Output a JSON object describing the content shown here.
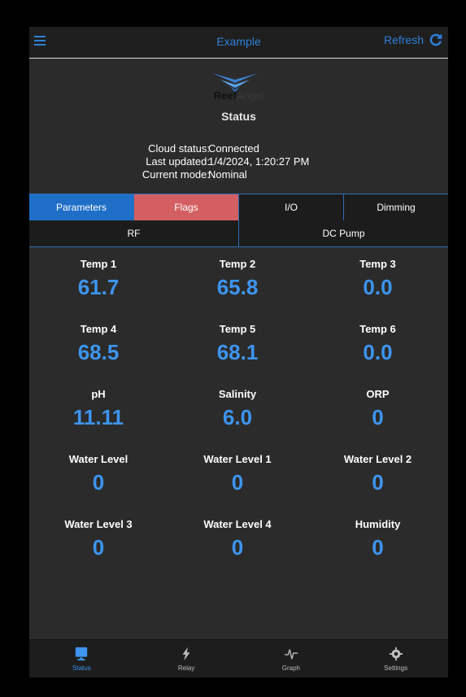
{
  "header": {
    "title": "Example",
    "refresh_label": "Refresh"
  },
  "logo": {
    "reef": "Reef",
    "angel": "Angel"
  },
  "status_heading": "Status",
  "info": [
    {
      "label": "Cloud status:",
      "value": "Connected"
    },
    {
      "label": "Last updated:",
      "value": "1/4/2024, 1:20:27 PM"
    },
    {
      "label": "Current mode:",
      "value": "Nominal"
    }
  ],
  "tabs_row1": [
    "Parameters",
    "Flags",
    "I/O",
    "Dimming"
  ],
  "tabs_row2": [
    "RF",
    "DC Pump"
  ],
  "params": [
    {
      "label": "Temp 1",
      "value": "61.7"
    },
    {
      "label": "Temp 2",
      "value": "65.8"
    },
    {
      "label": "Temp 3",
      "value": "0.0"
    },
    {
      "label": "Temp 4",
      "value": "68.5"
    },
    {
      "label": "Temp 5",
      "value": "68.1"
    },
    {
      "label": "Temp 6",
      "value": "0.0"
    },
    {
      "label": "pH",
      "value": "11.11"
    },
    {
      "label": "Salinity",
      "value": "6.0"
    },
    {
      "label": "ORP",
      "value": "0"
    },
    {
      "label": "Water Level",
      "value": "0"
    },
    {
      "label": "Water Level 1",
      "value": "0"
    },
    {
      "label": "Water Level 2",
      "value": "0"
    },
    {
      "label": "Water Level 3",
      "value": "0"
    },
    {
      "label": "Water Level 4",
      "value": "0"
    },
    {
      "label": "Humidity",
      "value": "0"
    }
  ],
  "bottom_nav": [
    {
      "label": "Status",
      "icon": "monitor-icon"
    },
    {
      "label": "Relay",
      "icon": "lightning-icon"
    },
    {
      "label": "Graph",
      "icon": "pulse-icon"
    },
    {
      "label": "Settings",
      "icon": "gear-icon"
    }
  ],
  "colors": {
    "accent": "#2f7fd8",
    "value": "#3d95ef",
    "flags": "#d35f62",
    "active_tab": "#1f6fc9"
  }
}
